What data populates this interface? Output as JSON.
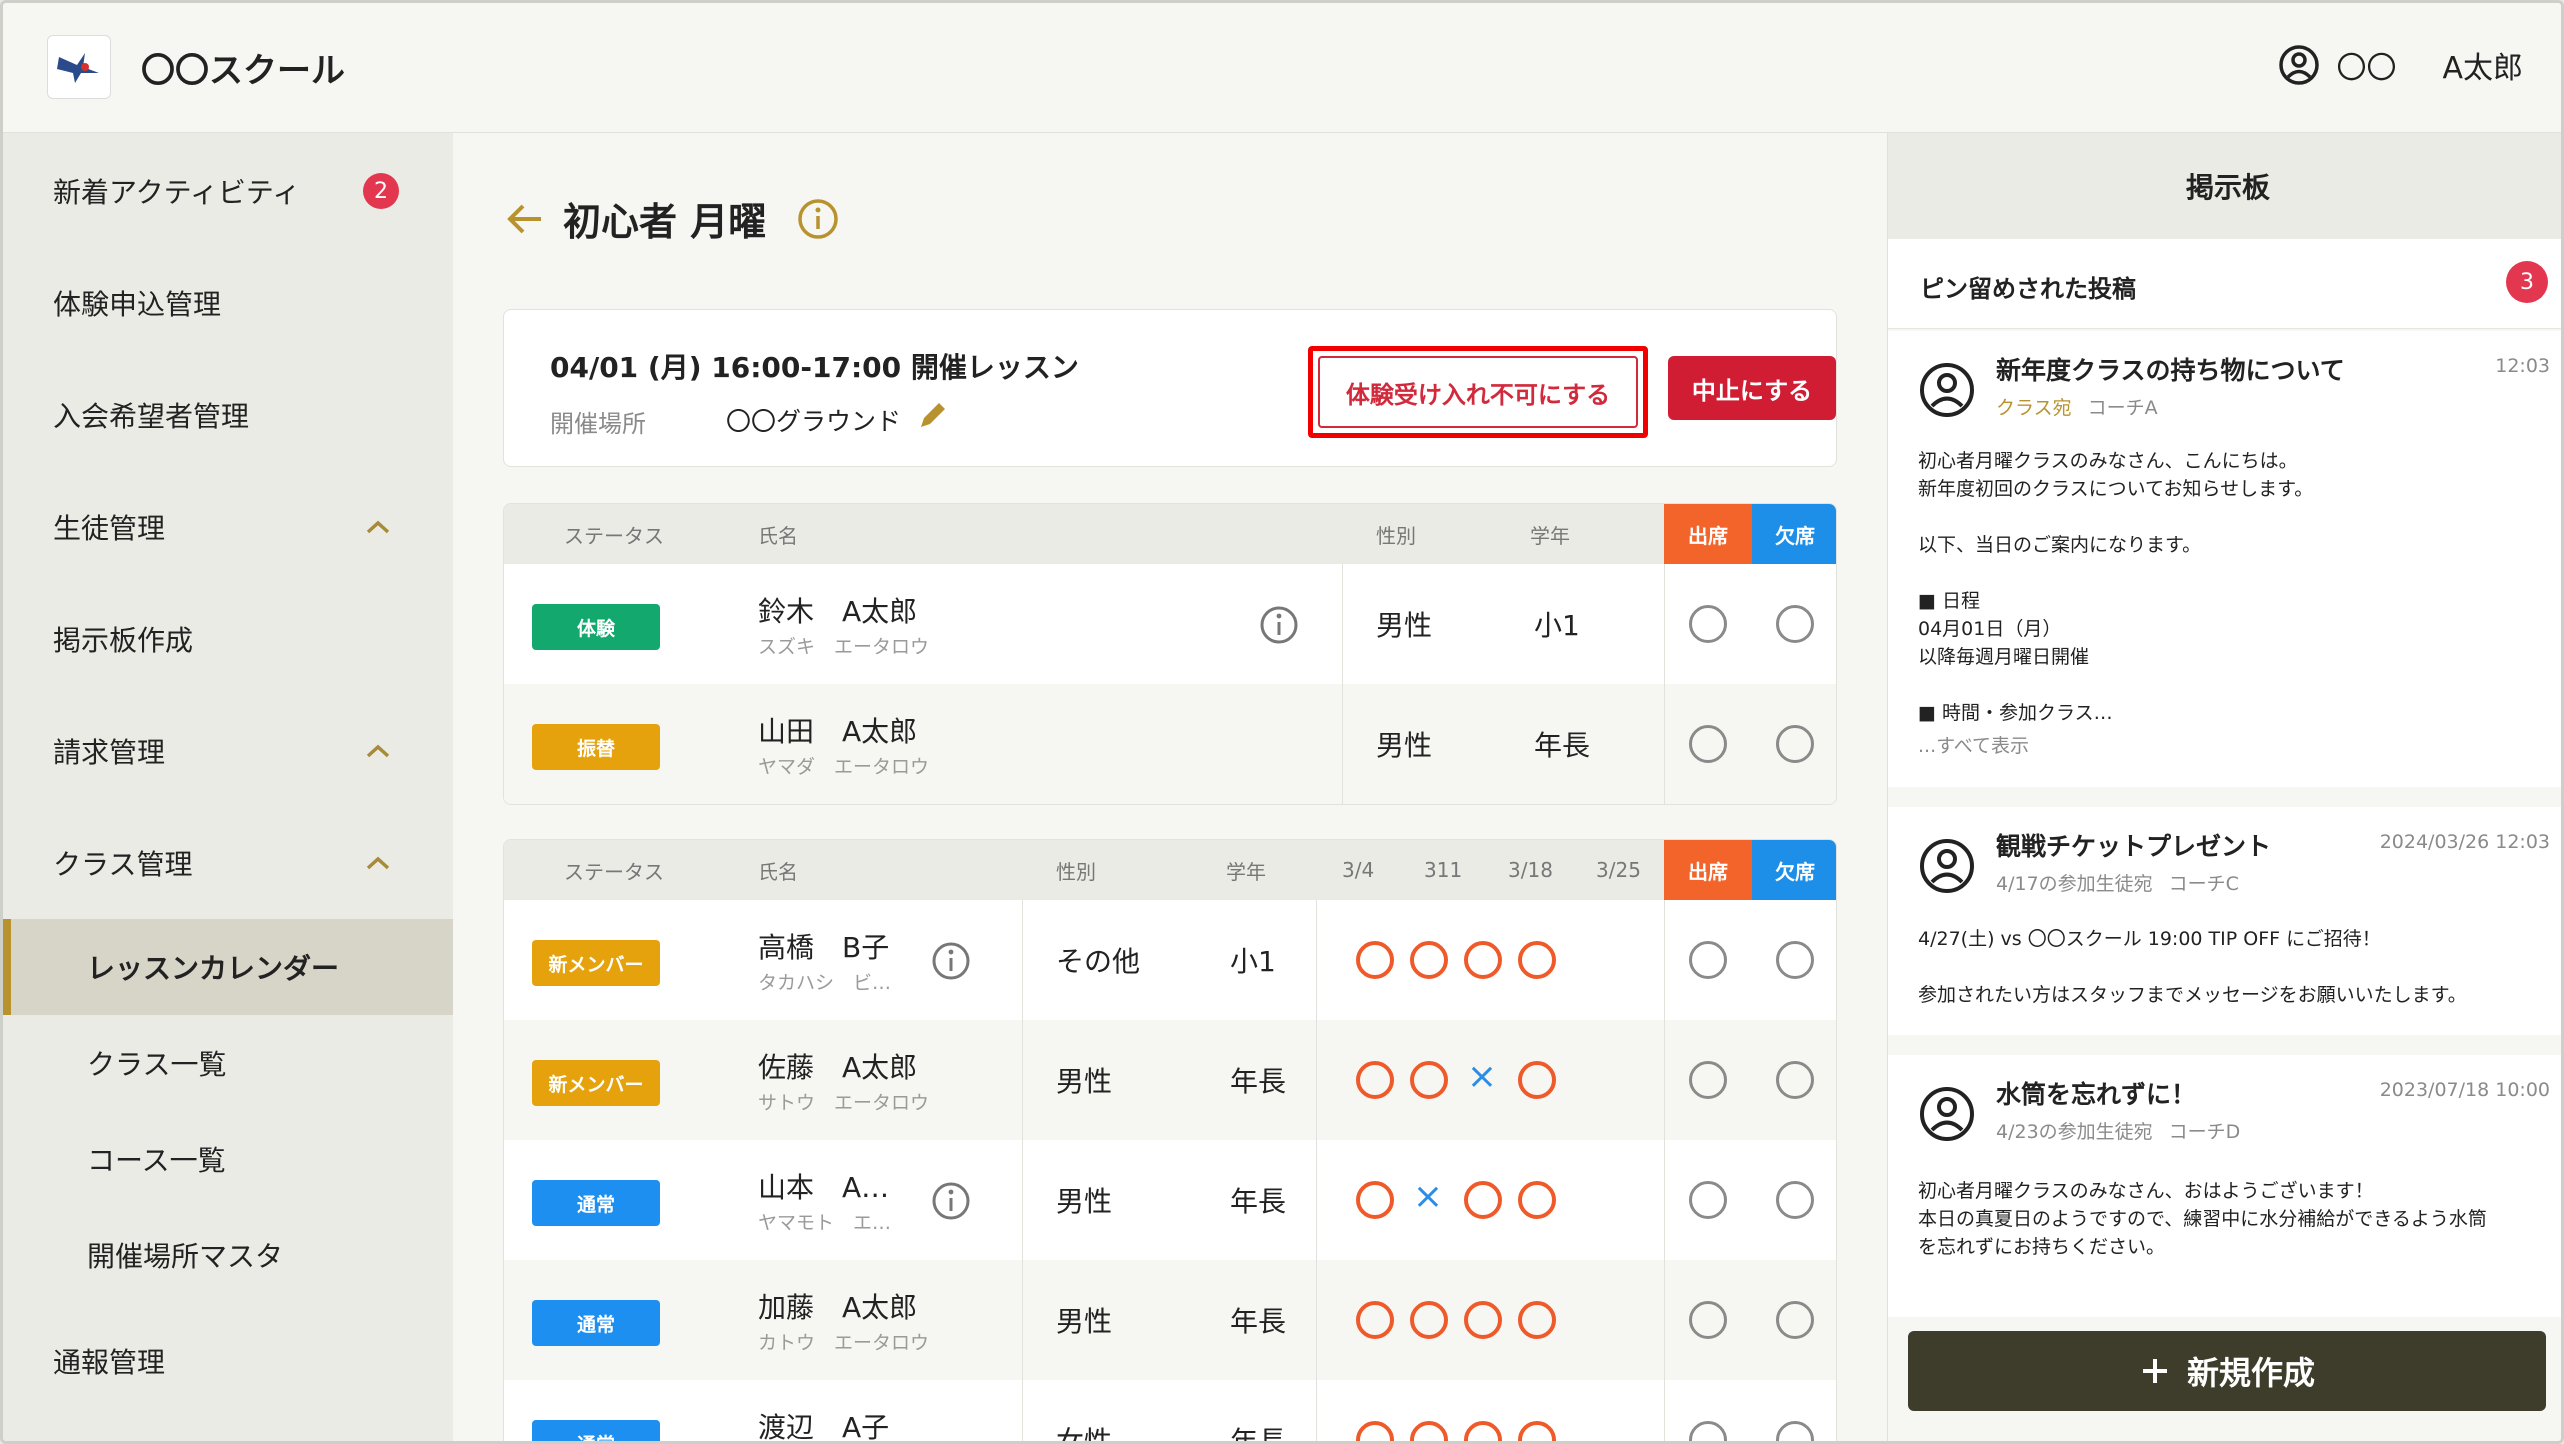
{
  "header": {
    "app_title": "〇〇スクール",
    "user_first": "〇〇",
    "user_last": "A太郎"
  },
  "sidebar": {
    "items": [
      {
        "label": "新着アクティビティ",
        "badge": "2"
      },
      {
        "label": "体験申込管理"
      },
      {
        "label": "入会希望者管理"
      },
      {
        "label": "生徒管理"
      },
      {
        "label": "掲示板作成"
      },
      {
        "label": "請求管理"
      },
      {
        "label": "クラス管理"
      }
    ],
    "sub_items": [
      {
        "label": "レッスンカレンダー",
        "active": true
      },
      {
        "label": "クラス一覧"
      },
      {
        "label": "コース一覧"
      },
      {
        "label": "開催場所マスタ"
      }
    ],
    "last_item": {
      "label": "通報管理"
    }
  },
  "main": {
    "page_title": "初心者 月曜",
    "lesson": {
      "title": "04/01 (月) 16:00-17:00 開催レッスン",
      "venue_label": "開催場所",
      "venue_value": "〇〇グラウンド",
      "reject_trial_label": "体験受け入れ不可にする",
      "cancel_label": "中止にする"
    },
    "trial_table": {
      "headers": {
        "status": "ステータス",
        "name": "氏名",
        "gender": "性別",
        "grade": "学年",
        "attend": "出席",
        "absent": "欠席"
      },
      "rows": [
        {
          "status": "体験",
          "name": "鈴木　A太郎",
          "kana": "スズキ　エータロウ",
          "gender": "男性",
          "grade": "小1"
        },
        {
          "status": "振替",
          "name": "山田　A太郎",
          "kana": "ヤマダ　エータロウ",
          "gender": "男性",
          "grade": "年長"
        }
      ]
    },
    "member_table": {
      "headers": {
        "status": "ステータス",
        "name": "氏名",
        "gender": "性別",
        "grade": "学年",
        "d1": "3/4",
        "d2": "311",
        "d3": "3/18",
        "d4": "3/25",
        "attend": "出席",
        "absent": "欠席"
      },
      "rows": [
        {
          "status": "新メンバー",
          "name": "高橋　B子",
          "kana": "タカハシ　ビ…",
          "gender": "その他",
          "grade": "小1",
          "history": [
            "o",
            "o",
            "o",
            "o"
          ]
        },
        {
          "status": "新メンバー",
          "name": "佐藤　A太郎",
          "kana": "サトウ　エータロウ",
          "gender": "男性",
          "grade": "年長",
          "history": [
            "o",
            "o",
            "x",
            "o"
          ]
        },
        {
          "status": "通常",
          "name": "山本　A…",
          "kana": "ヤマモト　エ…",
          "gender": "男性",
          "grade": "年長",
          "history": [
            "o",
            "x",
            "o",
            "o"
          ]
        },
        {
          "status": "通常",
          "name": "加藤　A太郎",
          "kana": "カトウ　エータロウ",
          "gender": "男性",
          "grade": "年長",
          "history": [
            "o",
            "o",
            "o",
            "o"
          ]
        },
        {
          "status": "通常",
          "name": "渡辺　A子",
          "kana": "",
          "gender": "女性",
          "grade": "年長",
          "history": [
            "o",
            "o",
            "o",
            "o"
          ]
        }
      ]
    }
  },
  "board": {
    "title": "掲示板",
    "pinned_label": "ピン留めされた投稿",
    "pinned_count": "3",
    "posts": [
      {
        "title": "新年度クラスの持ち物について",
        "time": "12:03",
        "audience": "クラス宛",
        "author": "コーチA",
        "body": "初心者月曜クラスのみなさん、こんにちは。\n新年度初回のクラスについてお知らせします。\n\n以下、当日のご案内になります。\n\n■ 日程\n04月01日（月）\n以降毎週月曜日開催\n\n■ 時間・参加クラス…",
        "more": "...すべて表示"
      },
      {
        "title": "観戦チケットプレゼント",
        "time": "2024/03/26  12:03",
        "audience": "4/17の参加生徒宛",
        "author": "コーチC",
        "body": "4/27(土) vs 〇〇スクール 19:00 TIP OFF  にご招待！\n\n参加されたい方はスタッフまでメッセージをお願いいたします。"
      },
      {
        "title": "水筒を忘れずに！",
        "time": "2023/07/18  10:00",
        "audience": "4/23の参加生徒宛",
        "author": "コーチD",
        "body": "初心者月曜クラスのみなさん、おはようございます！\n本日の真夏日のようですので、練習中に水分補給ができるよう水筒\nを忘れずにお持ちください。"
      }
    ],
    "new_button": "新規作成"
  }
}
